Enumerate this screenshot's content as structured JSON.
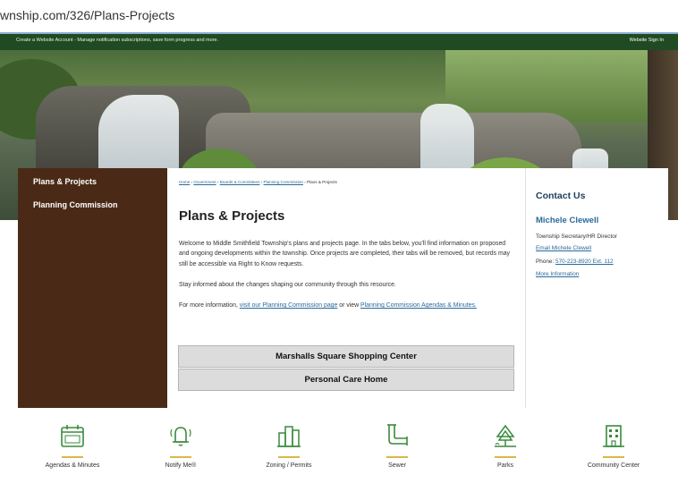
{
  "browser": {
    "url": "wnship.com/326/Plans-Projects"
  },
  "topbar": {
    "message": "Create a Website Account - Manage notification subscriptions, save form progress and more.",
    "signin": "Website Sign In"
  },
  "sidebar": {
    "items": [
      {
        "label": "Plans & Projects"
      },
      {
        "label": "Planning Commission"
      }
    ]
  },
  "main": {
    "breadcrumb": {
      "home": "Home",
      "government": "Government",
      "boards": "Boards & Committees",
      "planning": "Planning Commission",
      "current": "Plans & Projects",
      "sep": " › "
    },
    "title": "Plans & Projects",
    "paragraph1": "Welcome to Middle Smithfield Township's plans and projects page. In the tabs below, you'll find information on proposed and ongoing developments within the township. Once projects are completed, their tabs will be removed, but records may still be accessible via Right to Know requests.",
    "paragraph2": "Stay informed about the changes shaping our community through this resource.",
    "paragraph3_prefix": "For more information, ",
    "paragraph3_link1": "visit our Planning Commission page",
    "paragraph3_mid": " or view ",
    "paragraph3_link2": "Planning Commission Agendas & Minutes.",
    "accordions": [
      {
        "label": "Marshalls Square Shopping Center"
      },
      {
        "label": "Personal Care Home"
      }
    ]
  },
  "contact": {
    "heading": "Contact Us",
    "name": "Michele Clewell",
    "role": "Township Secretary/HR Director",
    "email": "Email Michele Clewell",
    "phone_label": "Phone: ",
    "phone": "570-223-8920 Ext. 112",
    "more": "More Information"
  },
  "quicklinks": [
    {
      "label": "Agendas & Minutes",
      "icon": "calendar-icon"
    },
    {
      "label": "Notify Me®",
      "icon": "bell-icon"
    },
    {
      "label": "Zoning / Permits",
      "icon": "buildings-icon"
    },
    {
      "label": "Sewer",
      "icon": "pipe-icon"
    },
    {
      "label": "Parks",
      "icon": "park-icon"
    },
    {
      "label": "Community Center",
      "icon": "building-icon"
    }
  ],
  "colors": {
    "topbar": "#1f4a22",
    "sidebar": "#4a2a17",
    "link": "#2a6a9a",
    "accent": "#d9b84a"
  }
}
